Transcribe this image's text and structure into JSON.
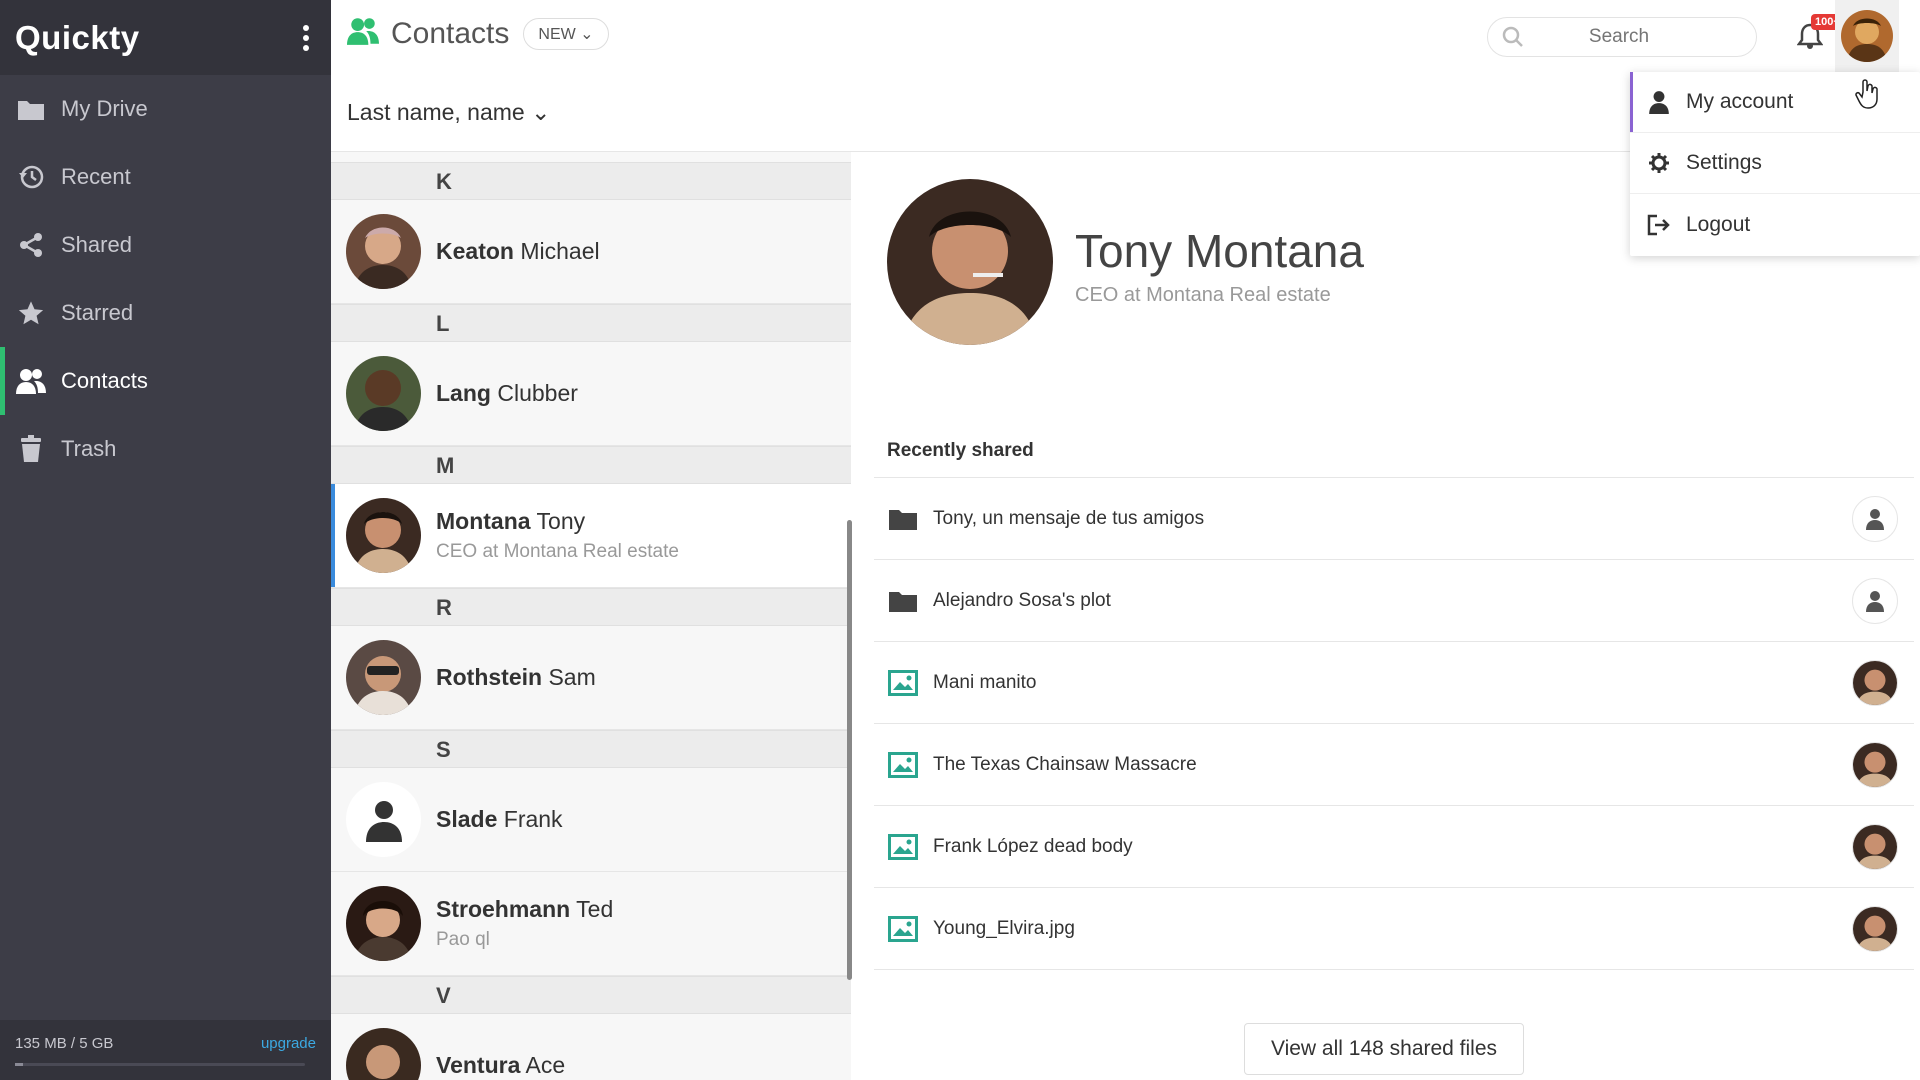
{
  "app": {
    "brand": "Quickty",
    "accent": "#2fbf71"
  },
  "sidebar": {
    "items": [
      {
        "label": "My Drive",
        "icon": "folder-icon"
      },
      {
        "label": "Recent",
        "icon": "history-icon"
      },
      {
        "label": "Shared",
        "icon": "share-icon"
      },
      {
        "label": "Starred",
        "icon": "star-icon"
      },
      {
        "label": "Contacts",
        "icon": "contacts-icon",
        "active": true
      },
      {
        "label": "Trash",
        "icon": "trash-icon"
      }
    ],
    "storage": {
      "used": "135 MB / 5 GB",
      "upgrade": "upgrade",
      "fraction": 0.026
    }
  },
  "header": {
    "title": "Contacts",
    "new_label": "NEW",
    "search_placeholder": "Search",
    "notification_badge": "100+"
  },
  "sort": {
    "label": "Last name, name"
  },
  "contacts": [
    {
      "letter": "K"
    },
    {
      "last": "Keaton",
      "first": "Michael",
      "sub": ""
    },
    {
      "letter": "L"
    },
    {
      "last": "Lang",
      "first": "Clubber",
      "sub": ""
    },
    {
      "letter": "M"
    },
    {
      "last": "Montana",
      "first": "Tony",
      "sub": "CEO at Montana Real estate",
      "selected": true
    },
    {
      "letter": "R"
    },
    {
      "last": "Rothstein",
      "first": "Sam",
      "sub": ""
    },
    {
      "letter": "S"
    },
    {
      "last": "Slade",
      "first": "Frank",
      "sub": "",
      "placeholder": true
    },
    {
      "last": "Stroehmann",
      "first": "Ted",
      "sub": "Pao ql"
    },
    {
      "letter": "V"
    },
    {
      "last": "Ventura",
      "first": "Ace",
      "sub": ""
    }
  ],
  "detail": {
    "name": "Tony Montana",
    "role": "CEO at Montana Real estate",
    "recent_title": "Recently shared",
    "files": [
      {
        "name": "Tony, un mensaje de tus amigos",
        "type": "folder",
        "owner": "generic"
      },
      {
        "name": "Alejandro Sosa's plot",
        "type": "folder",
        "owner": "generic"
      },
      {
        "name": "Mani manito",
        "type": "image",
        "owner": "photo"
      },
      {
        "name": "The Texas Chainsaw Massacre",
        "type": "image",
        "owner": "photo"
      },
      {
        "name": "Frank López dead body",
        "type": "image",
        "owner": "photo"
      },
      {
        "name": "Young_Elvira.jpg",
        "type": "image",
        "owner": "photo"
      }
    ],
    "view_all": "View all 148 shared files"
  },
  "account_menu": {
    "items": [
      {
        "label": "My account",
        "icon": "user-icon"
      },
      {
        "label": "Settings",
        "icon": "gear-icon"
      },
      {
        "label": "Logout",
        "icon": "logout-icon"
      }
    ]
  }
}
